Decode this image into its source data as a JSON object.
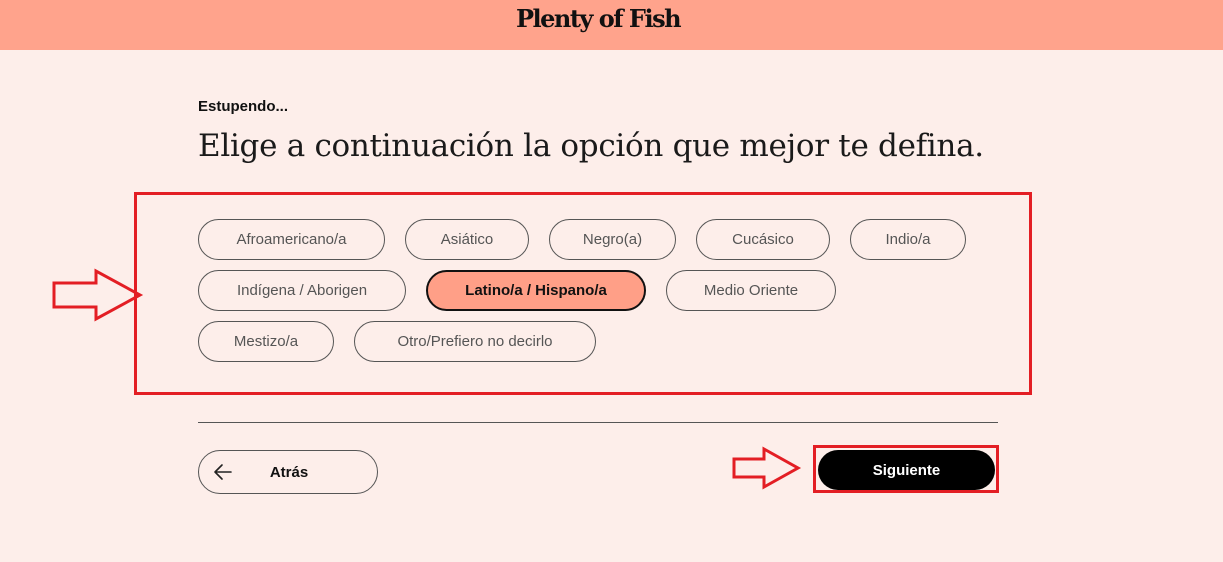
{
  "header": {
    "logo": "Plenty of Fish",
    "background": "#ffa38c"
  },
  "page": {
    "eyebrow": "Estupendo...",
    "heading": "Elige a continuación la opción que mejor te defina."
  },
  "options": [
    {
      "label": "Afroamericano/a",
      "selected": false
    },
    {
      "label": "Asiático",
      "selected": false
    },
    {
      "label": "Negro(a)",
      "selected": false
    },
    {
      "label": "Cucásico",
      "selected": false
    },
    {
      "label": "Indio/a",
      "selected": false
    },
    {
      "label": "Indígena / Aborigen",
      "selected": false
    },
    {
      "label": "Latino/a / Hispano/a",
      "selected": true
    },
    {
      "label": "Medio Oriente",
      "selected": false
    },
    {
      "label": "Mestizo/a",
      "selected": false
    },
    {
      "label": "Otro/Prefiero no decirlo",
      "selected": false
    }
  ],
  "footer": {
    "back_label": "Atrás",
    "back_icon": "arrow-left-icon",
    "next_label": "Siguiente"
  },
  "colors": {
    "page_bg": "#fdeeea",
    "selected_chip": "#ff9f87",
    "annotation": "#e31e24"
  }
}
